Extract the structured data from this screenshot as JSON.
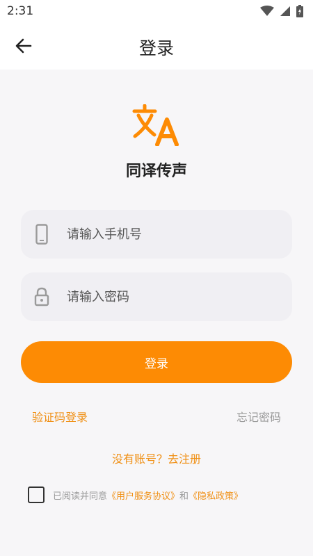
{
  "status_bar": {
    "time": "2:31"
  },
  "app_bar": {
    "title": "登录"
  },
  "brand": {
    "app_name": "同译传声",
    "accent_color": "#fd8b04"
  },
  "form": {
    "phone_placeholder": "请输入手机号",
    "password_placeholder": "请输入密码",
    "login_label": "登录"
  },
  "links": {
    "sms_login": "验证码登录",
    "forgot_password": "忘记密码",
    "register": "没有账号？去注册"
  },
  "agreement": {
    "prefix": "已阅读并同意",
    "terms": "《用户服务协议》",
    "conjunction": "和",
    "privacy": "《隐私政策》"
  },
  "icons": {
    "back": "arrow-left-icon",
    "phone": "smartphone-icon",
    "lock": "lock-icon",
    "logo": "translate-icon",
    "wifi": "wifi-icon",
    "signal": "signal-icon",
    "battery": "battery-icon"
  }
}
